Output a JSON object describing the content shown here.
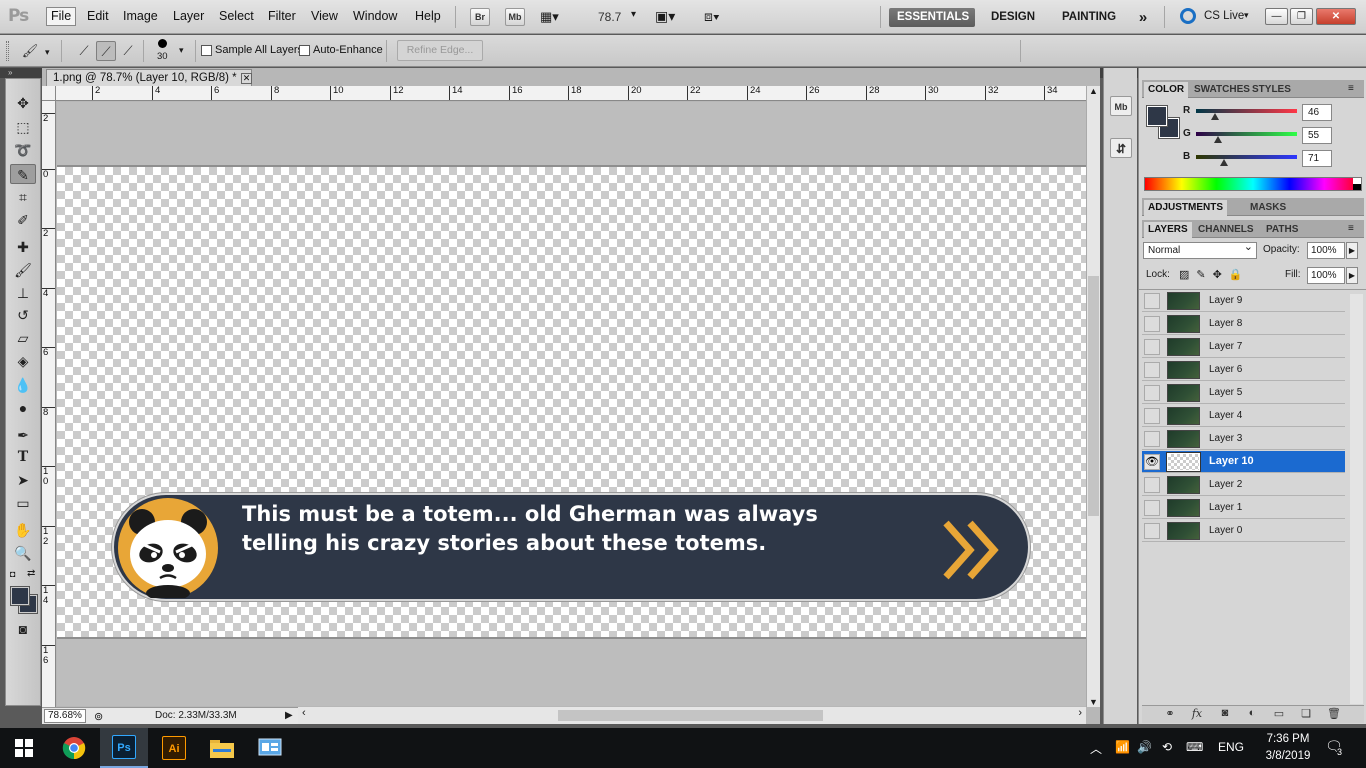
{
  "app": {
    "logo": "Ps"
  },
  "menu": [
    "File",
    "Edit",
    "Image",
    "Layer",
    "Select",
    "Filter",
    "View",
    "Window",
    "Help"
  ],
  "menubar": {
    "bridge_label": "Br",
    "minibridge_label": "Mb",
    "zoom_value": "78.7",
    "workspaces": [
      "ESSENTIALS",
      "DESIGN",
      "PAINTING"
    ],
    "more_workspaces": "»",
    "cs_live": "CS Live"
  },
  "options": {
    "brush_size": "30",
    "sample_all_layers": "Sample All Layers",
    "auto_enhance": "Auto-Enhance",
    "refine_edge": "Refine Edge..."
  },
  "document": {
    "tab_title": "1.png @ 78.7% (Layer 10, RGB/8) *",
    "close_glyph": "✕",
    "ruler_h": [
      "2",
      "4",
      "6",
      "8",
      "10",
      "12",
      "14",
      "16",
      "18",
      "20",
      "22",
      "24",
      "26",
      "28",
      "30",
      "32",
      "34"
    ],
    "ruler_v": [
      "2",
      "0",
      "2",
      "4",
      "6",
      "8",
      "1\n0",
      "1\n2",
      "1\n4",
      "1\n6"
    ],
    "zoom_status": "78.68%",
    "doc_info": "Doc: 2.33M/33.3M"
  },
  "banner": {
    "line1": "This must be a totem... old Gherman was always",
    "line2": "telling his crazy stories about these totems.",
    "bg_color": "#2e3747",
    "accent_color": "#e8a637"
  },
  "color_panel": {
    "tabs": [
      "COLOR",
      "SWATCHES",
      "STYLES"
    ],
    "r_label": "R",
    "g_label": "G",
    "b_label": "B",
    "r": "46",
    "g": "55",
    "b": "71",
    "fg_color": "#2e3747"
  },
  "adjust_panel": {
    "tabs": [
      "ADJUSTMENTS",
      "MASKS"
    ]
  },
  "layers_panel": {
    "tabs": [
      "LAYERS",
      "CHANNELS",
      "PATHS"
    ],
    "blend_mode": "Normal",
    "opacity_label": "Opacity:",
    "opacity": "100%",
    "lock_label": "Lock:",
    "fill_label": "Fill:",
    "fill": "100%",
    "layers": [
      "Layer 9",
      "Layer 8",
      "Layer 7",
      "Layer 6",
      "Layer 5",
      "Layer 4",
      "Layer 3",
      "Layer 10",
      "Layer 2",
      "Layer 1",
      "Layer 0"
    ],
    "selected": "Layer 10"
  },
  "taskbar": {
    "language": "ENG",
    "time": "7:36 PM",
    "date": "3/8/2019",
    "notifications": "3",
    "apps": [
      "chrome",
      "photoshop",
      "illustrator",
      "file-explorer",
      "control-panel"
    ]
  }
}
